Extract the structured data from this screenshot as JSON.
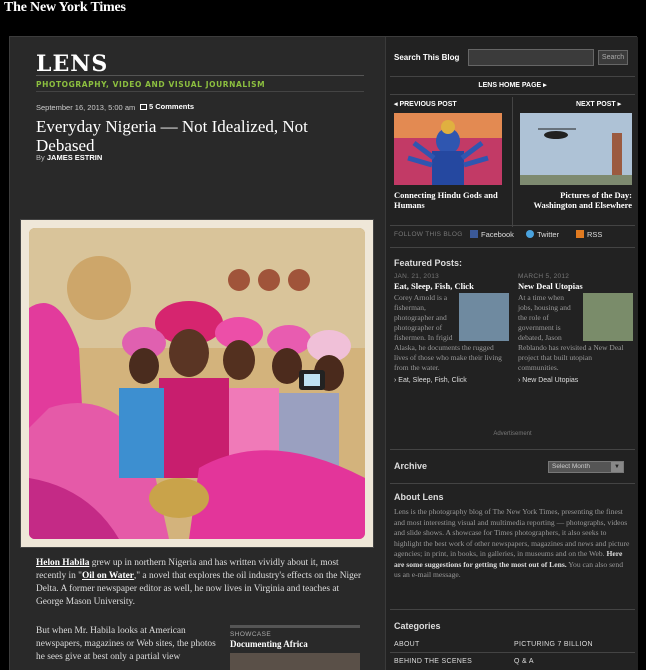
{
  "masthead": "The New York Times",
  "blog": {
    "logo": "LENS",
    "tagline": "PHOTOGRAPHY, VIDEO AND VISUAL JOURNALISM"
  },
  "article": {
    "date": "September 16, 2013, 5:00 am",
    "comments": "5 Comments",
    "headline": "Everyday Nigeria — Not Idealized, Not Debased",
    "byline_prefix": "By",
    "author": "JAMES ESTRIN",
    "p1_link1": "Helon Habila",
    "p1_a": " grew up in northern Nigeria and has written vividly about it, most recently in \"",
    "p1_link2": "Oil on Water",
    "p1_b": ",\" a novel that explores the oil industry's effects on the Niger Delta. A former newspaper editor as well, he now lives in Virginia and teaches at George Mason University.",
    "p2": "But when Mr. Habila looks at American newspapers, magazines or Web sites, the photos he sees give at best only a partial view"
  },
  "showcase": {
    "label": "SHOWCASE",
    "title": "Documenting Africa"
  },
  "sidebar": {
    "search_label": "Search This Blog",
    "search_value": "",
    "search_button": "Search",
    "home_link": "LENS HOME PAGE ▸",
    "prev_label": "◂  PREVIOUS POST",
    "next_label": "NEXT POST  ▸",
    "prev_title": "Connecting Hindu Gods and Humans",
    "next_title": "Pictures of the Day: Washington and Elsewhere",
    "follow_label": "FOLLOW THIS BLOG",
    "facebook": "Facebook",
    "twitter": "Twitter",
    "rss": "RSS",
    "featured_title": "Featured Posts:",
    "featured": [
      {
        "date": "JAN. 21, 2013",
        "title": "Eat, Sleep, Fish, Click",
        "text": "Corey Arnold is a fisherman, photographer and photographer of fishermen. In frigid Alaska, he documents the rugged lives of those who make their living from the water.",
        "link": "› Eat, Sleep, Fish, Click"
      },
      {
        "date": "MARCH 5, 2012",
        "title": "New Deal Utopias",
        "text": "At a time when jobs, housing and the role of government is debated, Jason Reblando has revisited a New Deal project that built utopian communities.",
        "link": "› New Deal Utopias"
      }
    ],
    "ad_label": "Advertisement",
    "archive_title": "Archive",
    "archive_select": "Select Month",
    "about_title": "About Lens",
    "about_text": "Lens is the photography blog of The New York Times, presenting the finest and most interesting visual and multimedia reporting — photographs, videos and slide shows. A showcase for Times photographers, it also seeks to highlight the best work of other newspapers, magazines and news and picture agencies; in print, in books, in galleries, in museums and on the Web. ",
    "about_bold": "Here are some suggestions for getting the most out of Lens.",
    "about_tail": " You can also send us an e-mail message.",
    "categories_title": "Categories",
    "categories": [
      "ABOUT",
      "PICTURING 7 BILLION",
      "BEHIND THE SCENES",
      "Q & A"
    ]
  },
  "colors": {
    "accent_green": "#8cbf3f",
    "background": "#292929"
  }
}
